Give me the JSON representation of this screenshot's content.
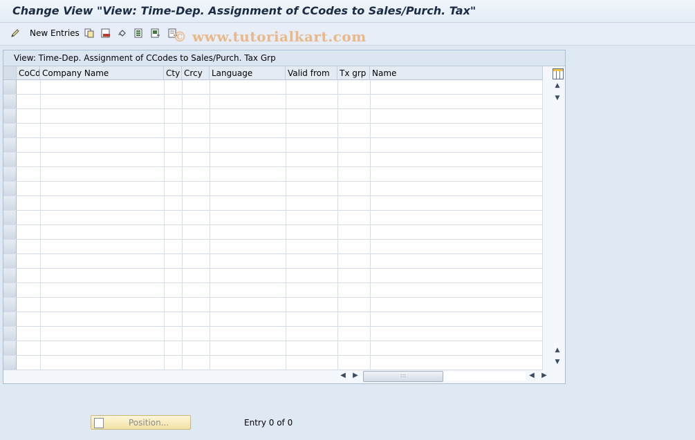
{
  "window": {
    "title": "Change View \"View: Time-Dep. Assignment of CCodes to Sales/Purch. Tax\""
  },
  "toolbar": {
    "new_entries_label": "New Entries",
    "icons": [
      "edit-pencil-icon",
      "copy-icon",
      "delete-icon",
      "undo-icon",
      "select-all-icon",
      "select-block-icon",
      "deselect-all-icon"
    ],
    "watermark": "© www.tutorialkart.com"
  },
  "table": {
    "title": "View: Time-Dep. Assignment of CCodes to Sales/Purch. Tax Grp",
    "columns": [
      "CoCd",
      "Company Name",
      "Cty",
      "Crcy",
      "Language",
      "Valid from",
      "Tx grp",
      "Name"
    ],
    "row_count": 20,
    "rows": []
  },
  "footer": {
    "position_button_label": "Position...",
    "entry_text": "Entry 0 of 0"
  }
}
